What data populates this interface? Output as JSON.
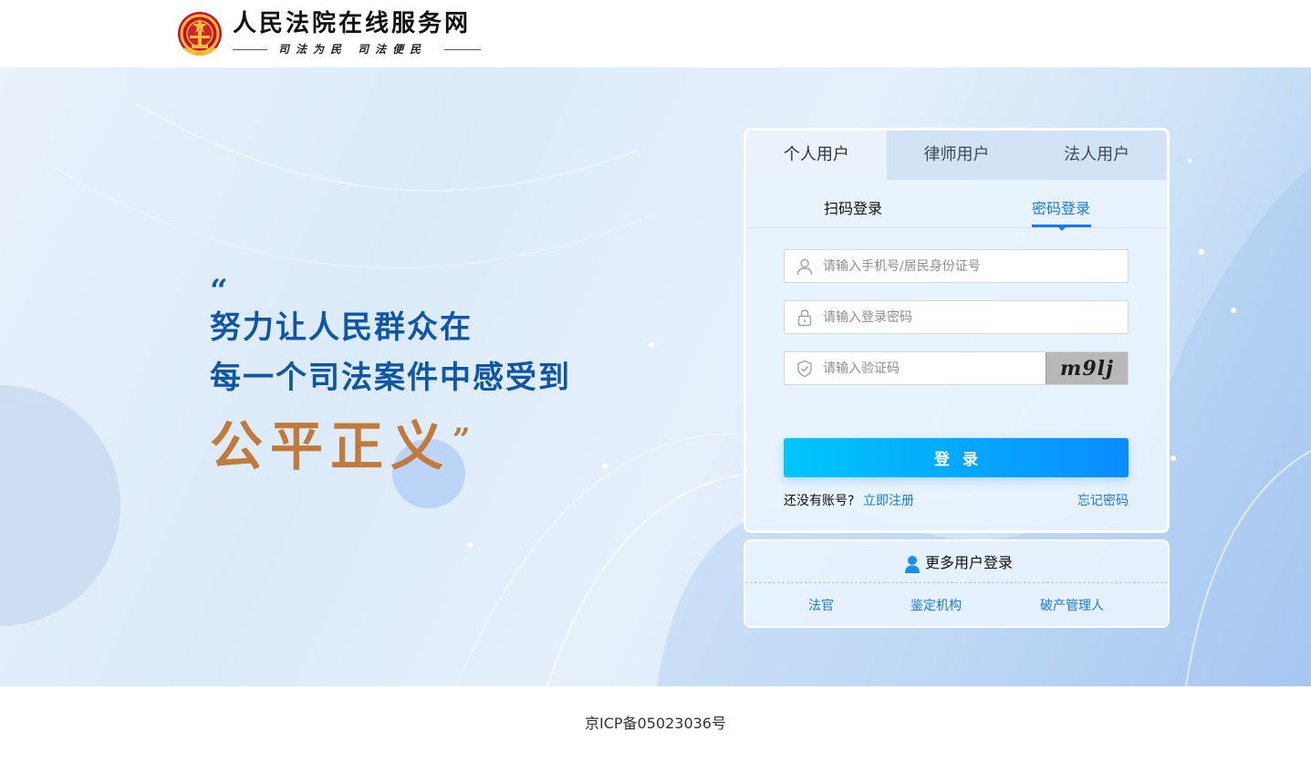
{
  "header": {
    "site_title": "人民法院在线服务网",
    "slogan": "司法为民 司法便民"
  },
  "hero": {
    "quote_open": "“",
    "line_1": "努力让人民群众在",
    "line_2": "每一个司法案件中感受到",
    "line_3": "公平正义",
    "quote_close": "”"
  },
  "login": {
    "user_tabs": [
      "个人用户",
      "律师用户",
      "法人用户"
    ],
    "active_user_tab": "个人用户",
    "mode_tabs": {
      "qr": "扫码登录",
      "password": "密码登录"
    },
    "active_mode": "密码登录",
    "phone_placeholder": "请输入手机号/居民身份证号",
    "password_placeholder": "请输入登录密码",
    "captcha_placeholder": "请输入验证码",
    "captcha_text": "m9lj",
    "login_button": "登录",
    "no_account_text": "还没有账号?",
    "register_link": "立即注册",
    "forgot_link": "忘记密码"
  },
  "more_users": {
    "title": "更多用户登录",
    "links": [
      "法官",
      "鉴定机构",
      "破产管理人"
    ]
  },
  "footer": {
    "icp": "京ICP备05023036号"
  },
  "colors": {
    "accent": "#1a7ae0",
    "button_start": "#00c6fb",
    "button_end": "#0a8cff",
    "quote_blue": "#0f56a6",
    "quote_gold": "#c27a3c"
  },
  "icons": {
    "emblem": "national-emblem-icon",
    "user": "user-icon",
    "lock": "lock-icon",
    "shield": "shield-check-icon",
    "more_users": "user-badge-icon"
  }
}
